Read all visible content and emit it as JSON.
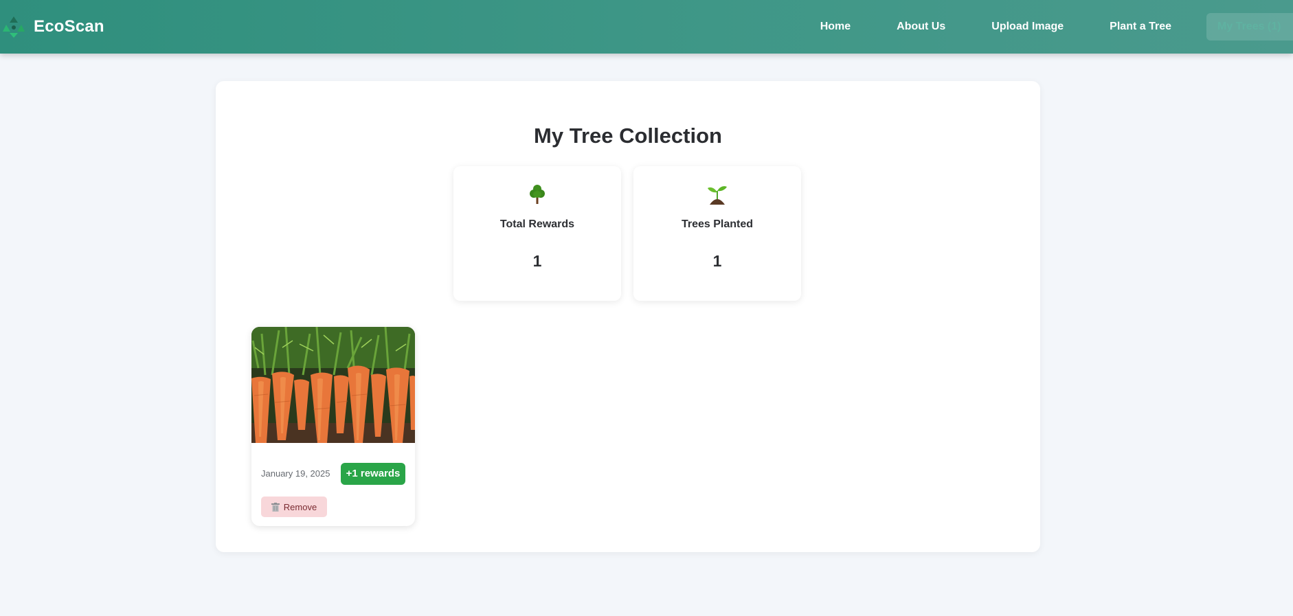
{
  "brand": {
    "name": "EcoScan",
    "logo_icon": "recycle-icon"
  },
  "nav": {
    "items": [
      {
        "label": "Home"
      },
      {
        "label": "About Us"
      },
      {
        "label": "Upload Image"
      },
      {
        "label": "Plant a Tree"
      },
      {
        "label": "My Trees (1)",
        "active": true
      }
    ]
  },
  "main": {
    "title": "My Tree Collection",
    "stats": [
      {
        "icon": "tree-icon",
        "label": "Total Rewards",
        "value": "1"
      },
      {
        "icon": "seedling-icon",
        "label": "Trees Planted",
        "value": "1"
      }
    ],
    "trees": [
      {
        "image": "carrots-photo",
        "date": "January 19, 2025",
        "reward": "+1 rewards",
        "remove_label": "Remove",
        "remove_icon": "trash-icon"
      }
    ]
  },
  "colors": {
    "nav_gradient_start": "#2f8f7d",
    "nav_gradient_end": "#4a9a8d",
    "reward_badge": "#2aa548",
    "remove_button_bg": "#f8d7da",
    "page_bg": "#f3f6fa"
  }
}
